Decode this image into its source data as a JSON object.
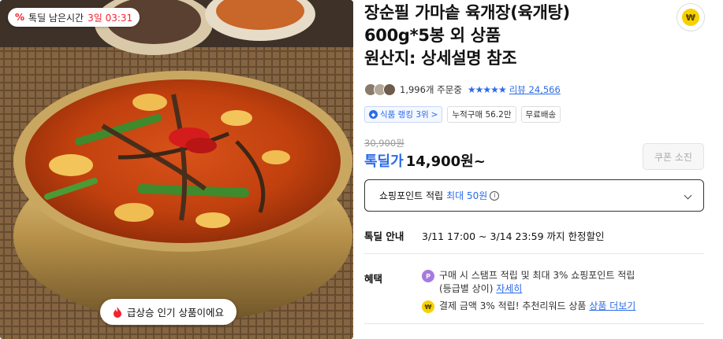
{
  "image": {
    "deal_badge": {
      "icon": "percent-icon",
      "label": "톡딜 남은시간",
      "time": "3일 03:31"
    },
    "trend_pill": {
      "icon": "fire-icon",
      "label": "급상승 인기 상품이에요"
    }
  },
  "product": {
    "title_lines": [
      "장순필 가마솥 육개장(육개탕)",
      "600g*5봉 외 상품",
      "원산지: 상세설명 참조"
    ],
    "pay_icon": "won-coin-icon",
    "orders": "1,996개 주문중",
    "stars": "★★★★★",
    "review_prefix": "리뷰",
    "review_count": "24,566",
    "tags": [
      {
        "label": "식품 랭킹 3위",
        "suffix": ">"
      },
      {
        "label": "누적구매 56.2만"
      },
      {
        "label": "무료배송"
      }
    ],
    "original_price": "30,900원",
    "deal_word": "톡딜가",
    "price": "14,900원~",
    "coupon_label": "쿠폰 소진",
    "points": {
      "label": "쇼핑포인트 적립",
      "max": "최대 50원",
      "info_icon": "i"
    },
    "deal_info": {
      "label": "톡딜 안내",
      "value": "3/11 17:00 ~ 3/14 23:59 까지 한정할인"
    },
    "benefits": {
      "label": "혜택",
      "item1": {
        "icon": "P",
        "text": "구매 시 스탬프 적립 및 최대 3% 쇼핑포인트 적립",
        "sub": "(등급별 상이)",
        "link": "자세히"
      },
      "item2": {
        "icon": "₩",
        "text": "결제 금액 3% 적립! 추천리워드 상품",
        "link": "상품 더보기"
      }
    }
  },
  "colors": {
    "accent": "#2c6be8",
    "deal_red": "#f5222d",
    "coin_yellow": "#f6d100"
  }
}
